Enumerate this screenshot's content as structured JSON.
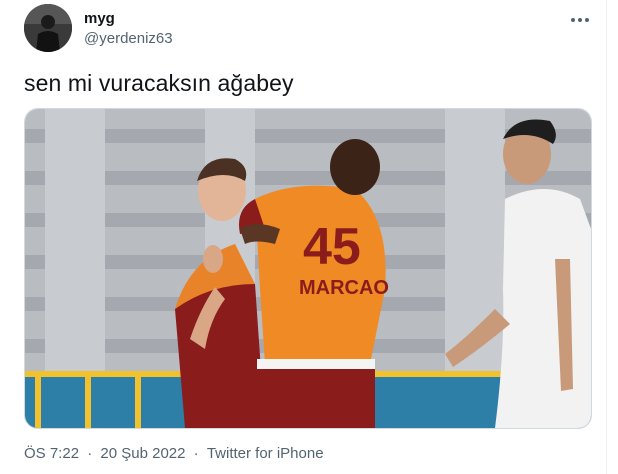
{
  "tweet": {
    "display_name": "myg",
    "handle": "@yerdeniz63",
    "text": "sen mi vuracaksın ağabey",
    "time": "ÖS 7:22",
    "date": "20 Şub 2022",
    "source": "Twitter for iPhone",
    "separator": "·"
  },
  "media": {
    "jersey_number": "45",
    "jersey_name": "MARCAO"
  },
  "colors": {
    "accent_orange": "#f08a24",
    "accent_red": "#8b1c1c",
    "secondary_text": "#536471",
    "border": "#cfd9de"
  },
  "icons": [
    "more-icon"
  ]
}
